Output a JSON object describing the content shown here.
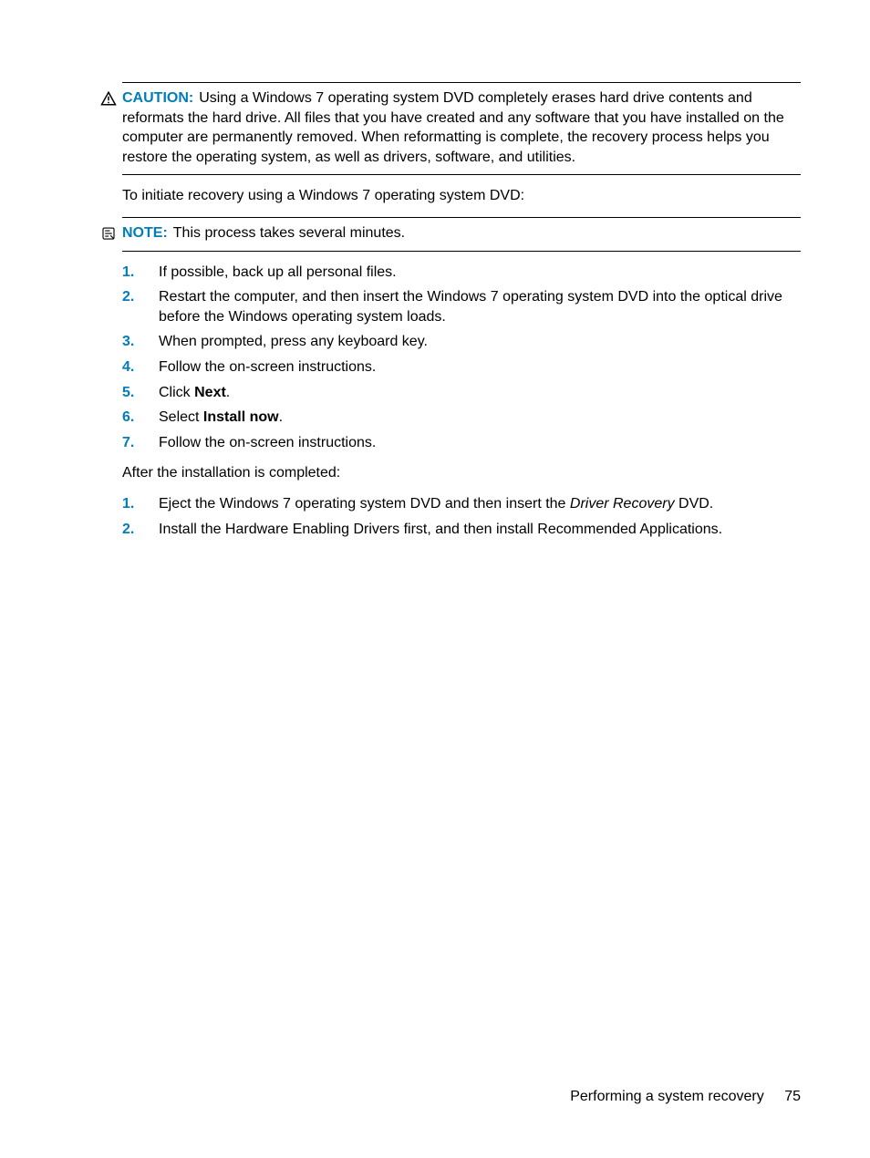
{
  "caution": {
    "label": "CAUTION:",
    "text": "Using a Windows 7 operating system DVD completely erases hard drive contents and reformats the hard drive. All files that you have created and any software that you have installed on the computer are permanently removed. When reformatting is complete, the recovery process helps you restore the operating system, as well as drivers, software, and utilities."
  },
  "initiate_text": "To initiate recovery using a Windows 7 operating system DVD:",
  "note": {
    "label": "NOTE:",
    "text": "This process takes several minutes."
  },
  "steps1": [
    {
      "num": "1.",
      "text": "If possible, back up all personal files."
    },
    {
      "num": "2.",
      "text": "Restart the computer, and then insert the Windows 7 operating system DVD into the optical drive before the Windows operating system loads."
    },
    {
      "num": "3.",
      "text": "When prompted, press any keyboard key."
    },
    {
      "num": "4.",
      "text": "Follow the on-screen instructions."
    },
    {
      "num": "5.",
      "pre": "Click ",
      "bold": "Next",
      "post": "."
    },
    {
      "num": "6.",
      "pre": "Select ",
      "bold": "Install now",
      "post": "."
    },
    {
      "num": "7.",
      "text": "Follow the on-screen instructions."
    }
  ],
  "after_text": "After the installation is completed:",
  "steps2": [
    {
      "num": "1.",
      "pre": "Eject the Windows 7 operating system DVD and then insert the ",
      "italic": "Driver Recovery",
      "post": " DVD."
    },
    {
      "num": "2.",
      "text": "Install the Hardware Enabling Drivers first, and then install Recommended Applications."
    }
  ],
  "footer": {
    "section": "Performing a system recovery",
    "page": "75"
  }
}
